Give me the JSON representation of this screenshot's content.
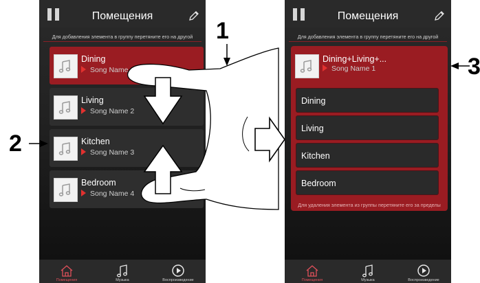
{
  "left_screen": {
    "title": "Помещения",
    "hint": "Для добавления элемента в группу перетяните его на другой",
    "rooms": [
      {
        "name": "Dining",
        "song": "Song Name 1"
      },
      {
        "name": "Living",
        "song": "Song Name 2"
      },
      {
        "name": "Kitchen",
        "song": "Song Name 3"
      },
      {
        "name": "Bedroom",
        "song": "Song Name 4"
      }
    ]
  },
  "right_screen": {
    "title": "Помещения",
    "hint": "Для добавления элемента в группу перетяните его на другой",
    "group": {
      "name": "Dining+Living+...",
      "song": "Song Name 1",
      "members": [
        "Dining",
        "Living",
        "Kitchen",
        "Bedroom"
      ],
      "footer": "Для удаления элемента из группы перетяните его за пределы"
    }
  },
  "tabs": [
    "Помещения",
    "Музыка",
    "Воспроизведение"
  ],
  "callouts": {
    "one": "1",
    "two": "2",
    "three": "3"
  },
  "colors": {
    "accent": "#9a1c22",
    "play": "#e2312f"
  }
}
